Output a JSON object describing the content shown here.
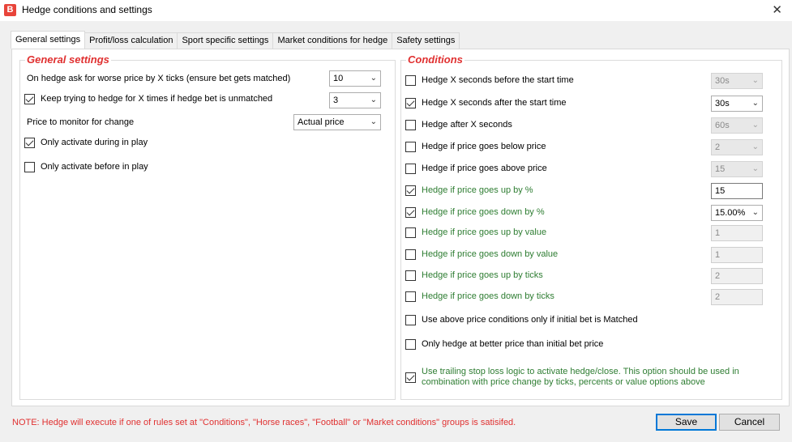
{
  "window": {
    "title": "Hedge conditions and settings",
    "app_icon_glyph": "B",
    "close_glyph": "✕"
  },
  "tabs": [
    {
      "label": "General settings",
      "active": true
    },
    {
      "label": "Profit/loss calculation"
    },
    {
      "label": "Sport specific settings"
    },
    {
      "label": "Market conditions for hedge"
    },
    {
      "label": "Safety settings"
    }
  ],
  "general": {
    "title": "General settings",
    "worse_price_label": "On hedge ask for worse price by X ticks (ensure bet gets matched)",
    "worse_price_value": "10",
    "keep_trying_label": "Keep trying to hedge for X times if hedge bet is unmatched",
    "keep_trying_value": "3",
    "price_monitor_label": "Price to monitor for change",
    "price_monitor_value": "Actual price",
    "only_in_play_label": "Only activate during in play",
    "only_before_label": "Only activate before in play"
  },
  "conditions": {
    "title": "Conditions",
    "items": [
      {
        "label": "Hedge X seconds before the start time",
        "checked": false,
        "green": false,
        "value": "30s",
        "control": "select",
        "enabled": false
      },
      {
        "label": "Hedge X seconds after the start time",
        "checked": true,
        "green": false,
        "value": "30s",
        "control": "select",
        "enabled": true
      },
      {
        "label": "Hedge after X seconds",
        "checked": false,
        "green": false,
        "value": "60s",
        "control": "select",
        "enabled": false
      },
      {
        "label": "Hedge if price goes below price",
        "checked": false,
        "green": false,
        "value": "2",
        "control": "select",
        "enabled": false
      },
      {
        "label": "Hedge if price goes above price",
        "checked": false,
        "green": false,
        "value": "15",
        "control": "select",
        "enabled": false
      },
      {
        "label": "Hedge if price goes up by %",
        "checked": true,
        "green": true,
        "value": "15",
        "control": "input",
        "enabled": true
      },
      {
        "label": "Hedge if price goes down by %",
        "checked": true,
        "green": true,
        "value": "15.00%",
        "control": "select",
        "enabled": true
      },
      {
        "label": "Hedge if price goes up by value",
        "checked": false,
        "green": true,
        "value": "1",
        "control": "input",
        "enabled": false
      },
      {
        "label": "Hedge if price goes down by value",
        "checked": false,
        "green": true,
        "value": "1",
        "control": "input",
        "enabled": false
      },
      {
        "label": "Hedge if price goes up by ticks",
        "checked": false,
        "green": true,
        "value": "2",
        "control": "input",
        "enabled": false
      },
      {
        "label": "Hedge if price goes down by ticks",
        "checked": false,
        "green": true,
        "value": "2",
        "control": "input",
        "enabled": false
      }
    ],
    "matched_only_label": "Use above price conditions only if initial bet is Matched",
    "better_price_label": "Only hedge at better price than initial bet price",
    "trailing_line1": "Use trailing stop loss logic to activate hedge/close. This option should be used in",
    "trailing_line2": "combination with price change by ticks, percents or value options above"
  },
  "footer": {
    "note": "NOTE: Hedge will execute if one of rules set at \"Conditions\", \"Horse races\", \"Football\" or \"Market conditions\" groups is satisifed.",
    "save_label": "Save",
    "cancel_label": "Cancel"
  },
  "colors": {
    "heading": "#e03030",
    "green_text": "#2e7d32",
    "accent": "#0078d7"
  }
}
